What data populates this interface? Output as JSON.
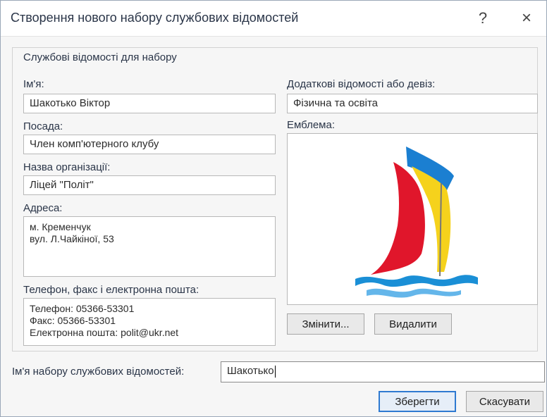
{
  "dialog": {
    "title": "Створення нового набору службових відомостей",
    "help_symbol": "?",
    "close_symbol": "×"
  },
  "group": {
    "legend": "Службові відомості для набору"
  },
  "fields": {
    "name_label": "Ім'я:",
    "name_value": "Шакотько Віктор",
    "position_label": "Посада:",
    "position_value": "Член комп'ютерного клубу",
    "org_label": "Назва організації:",
    "org_value": "Ліцей \"Політ\"",
    "address_label": "Адреса:",
    "address_lines": [
      "м. Кременчук",
      "вул. Л.Чайкіної, 53"
    ],
    "contacts_label": "Телефон, факс і електронна пошта:",
    "contacts_lines": [
      "Телефон: 05366-53301",
      "Факс: 05366-53301",
      "Електронна пошта: polit@ukr.net"
    ],
    "extra_label": "Додаткові відомості або девіз:",
    "extra_value": "Фізична та освіта",
    "emblem_label": "Емблема:"
  },
  "emblem_colors": {
    "blue": "#1b7fd1",
    "yellow": "#f5d21c",
    "red": "#e0162b",
    "wave": "#1a8fd6"
  },
  "buttons": {
    "change": "Змінити...",
    "delete": "Видалити",
    "save": "Зберегти",
    "cancel": "Скасувати"
  },
  "set_name": {
    "label": "Ім'я набору службових відомостей:",
    "value": "Шакотько"
  }
}
